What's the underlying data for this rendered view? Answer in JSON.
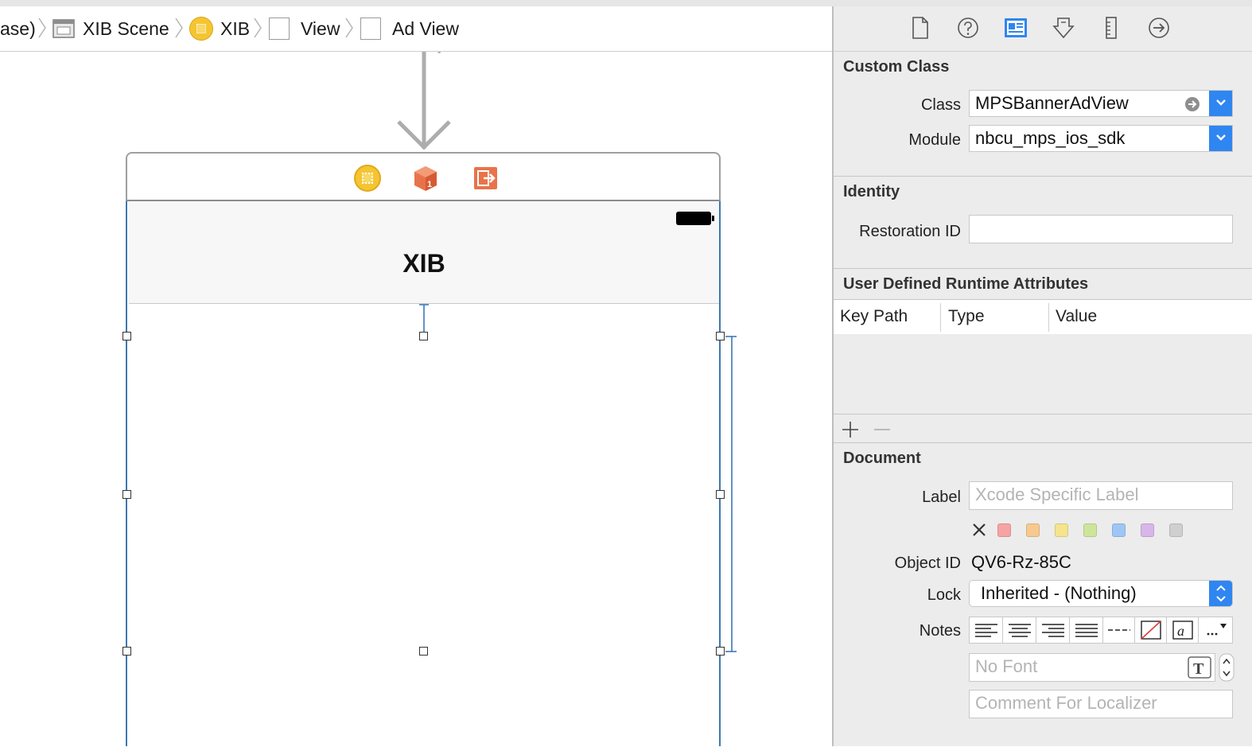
{
  "breadcrumbs": [
    "ase)",
    "XIB Scene",
    "XIB",
    "View",
    "Ad View"
  ],
  "scene": {
    "nav_title": "XIB"
  },
  "inspector": {
    "tabs": [
      "file-inspector",
      "quick-help",
      "identity-inspector",
      "attributes-inspector",
      "size-inspector",
      "connections-inspector"
    ],
    "active_tab": "identity-inspector",
    "custom_class": {
      "title": "Custom Class",
      "class_label": "Class",
      "class_value": "MPSBannerAdView",
      "module_label": "Module",
      "module_value": "nbcu_mps_ios_sdk"
    },
    "identity": {
      "title": "Identity",
      "restoration_label": "Restoration ID",
      "restoration_value": ""
    },
    "runtime_attributes": {
      "title": "User Defined Runtime Attributes",
      "columns": [
        "Key Path",
        "Type",
        "Value"
      ]
    },
    "document": {
      "title": "Document",
      "label_label": "Label",
      "label_placeholder": "Xcode Specific Label",
      "label_colors": [
        "#f6a3a3",
        "#f7c98f",
        "#f4e48e",
        "#cde59a",
        "#9ec6f4",
        "#d8b6ea",
        "#cfcfcf"
      ],
      "object_id_label": "Object ID",
      "object_id_value": "QV6-Rz-85C",
      "lock_label": "Lock",
      "lock_value": "Inherited - (Nothing)",
      "notes_label": "Notes",
      "font_placeholder": "No Font",
      "comment_placeholder": "Comment For Localizer"
    }
  },
  "colors": {
    "accent": "#2f86f1",
    "selection": "#3e78b0",
    "xib_yellow": "#f5c531",
    "dock_orange": "#e8734a"
  }
}
